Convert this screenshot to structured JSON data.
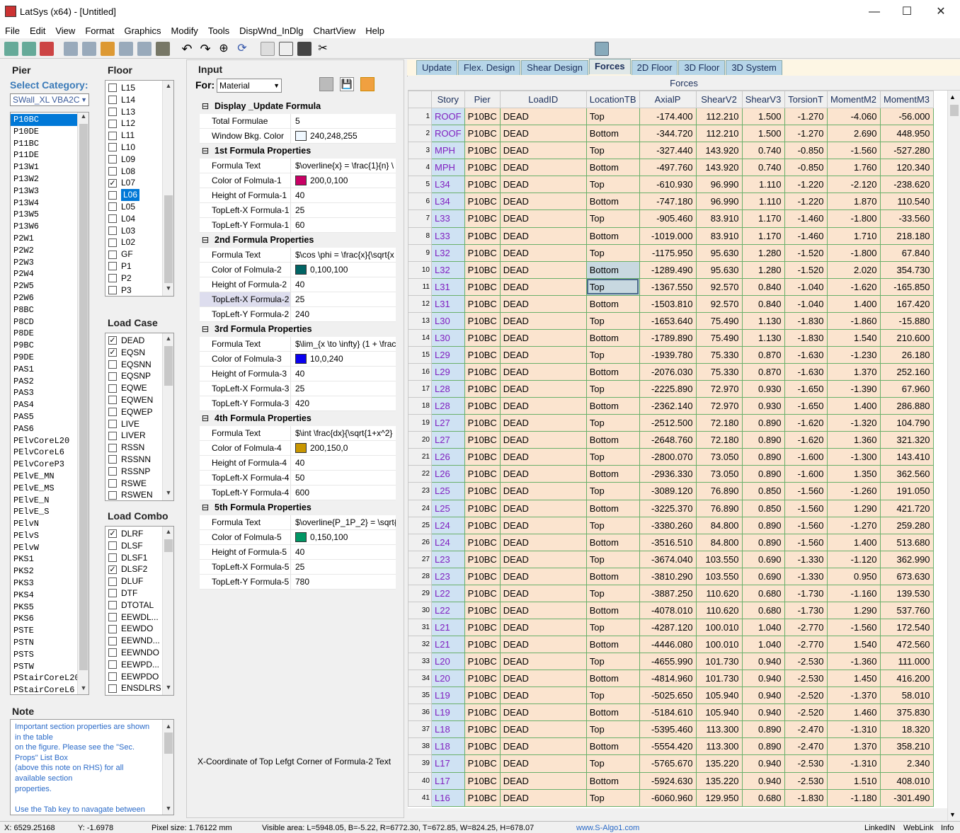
{
  "window": {
    "title": "LatSys (x64) - [Untitled]",
    "min": "—",
    "max": "☐",
    "close": "✕"
  },
  "menu": [
    "File",
    "Edit",
    "View",
    "Format",
    "Graphics",
    "Modify",
    "Tools",
    "DispWnd_InDlg",
    "ChartView",
    "Help"
  ],
  "pier": {
    "title": "Pier",
    "category_label": "Select Category:",
    "category_value": "SWall_XL VBA2C",
    "items": [
      "P10BC",
      "P10DE",
      "P11BC",
      "P11DE",
      "P13W1",
      "P13W2",
      "P13W3",
      "P13W4",
      "P13W5",
      "P13W6",
      "P2W1",
      "P2W2",
      "P2W3",
      "P2W4",
      "P2W5",
      "P2W6",
      "P8BC",
      "P8CD",
      "P8DE",
      "P9BC",
      "P9DE",
      "PAS1",
      "PAS2",
      "PAS3",
      "PAS4",
      "PAS5",
      "PAS6",
      "PElvCoreL20",
      "PElvCoreL6",
      "PElvCoreP3",
      "PElvE_MN",
      "PElvE_MS",
      "PElvE_N",
      "PElvE_S",
      "PElvN",
      "PElvS",
      "PElvW",
      "PKS1",
      "PKS2",
      "PKS3",
      "PKS4",
      "PKS5",
      "PKS6",
      "PSTE",
      "PSTN",
      "PSTS",
      "PSTW",
      "PStairCoreL20",
      "PStairCoreL6"
    ]
  },
  "floor": {
    "title": "Floor",
    "items": [
      {
        "l": "L15",
        "c": false
      },
      {
        "l": "L14",
        "c": false
      },
      {
        "l": "L13",
        "c": false
      },
      {
        "l": "L12",
        "c": false
      },
      {
        "l": "L11",
        "c": false
      },
      {
        "l": "L10",
        "c": false
      },
      {
        "l": "L09",
        "c": false
      },
      {
        "l": "L08",
        "c": false
      },
      {
        "l": "L07",
        "c": true
      },
      {
        "l": "L06",
        "c": false,
        "sel": true
      },
      {
        "l": "L05",
        "c": false
      },
      {
        "l": "L04",
        "c": false
      },
      {
        "l": "L03",
        "c": false
      },
      {
        "l": "L02",
        "c": false
      },
      {
        "l": "GF",
        "c": false
      },
      {
        "l": "P1",
        "c": false
      },
      {
        "l": "P2",
        "c": false
      },
      {
        "l": "P3",
        "c": false
      }
    ]
  },
  "load_case": {
    "title": "Load Case",
    "items": [
      {
        "l": "DEAD",
        "c": true
      },
      {
        "l": "EQSN",
        "c": true
      },
      {
        "l": "EQSNN",
        "c": false
      },
      {
        "l": "EQSNP",
        "c": false
      },
      {
        "l": "EQWE",
        "c": false
      },
      {
        "l": "EQWEN",
        "c": false
      },
      {
        "l": "EQWEP",
        "c": false
      },
      {
        "l": "LIVE",
        "c": false
      },
      {
        "l": "LIVER",
        "c": false
      },
      {
        "l": "RSSN",
        "c": false
      },
      {
        "l": "RSSNN",
        "c": false
      },
      {
        "l": "RSSNP",
        "c": false
      },
      {
        "l": "RSWE",
        "c": false
      },
      {
        "l": "RSWEN",
        "c": false
      }
    ]
  },
  "load_combo": {
    "title": "Load Combo",
    "items": [
      {
        "l": "DLRF",
        "c": true
      },
      {
        "l": "DLSF",
        "c": false
      },
      {
        "l": "DLSF1",
        "c": false
      },
      {
        "l": "DLSF2",
        "c": true
      },
      {
        "l": "DLUF",
        "c": false
      },
      {
        "l": "DTF",
        "c": false
      },
      {
        "l": "DTOTAL",
        "c": false
      },
      {
        "l": "EEWDL...",
        "c": false
      },
      {
        "l": "EEWDO",
        "c": false
      },
      {
        "l": "EEWND...",
        "c": false
      },
      {
        "l": "EEWNDO",
        "c": false
      },
      {
        "l": "EEWPD...",
        "c": false
      },
      {
        "l": "EEWPDO",
        "c": false
      },
      {
        "l": "ENSDLRS",
        "c": false
      }
    ]
  },
  "note": {
    "title": "Note",
    "lines": [
      "Important section properties are shown",
      "in the table",
      "on the figure. Please see the \"Sec.",
      "Props\" List Box",
      "(above this note on RHS) for all",
      "available section",
      "properties.",
      "",
      "Use the Tab key to navagate between"
    ]
  },
  "input": {
    "title": "Input",
    "for_label": "For:",
    "for_value": "Material",
    "hint": "X-Coordinate of Top Lefgt Corner of Formula-2 Text",
    "sections": [
      {
        "title": "Display _Update Formula",
        "rows": [
          {
            "k": "Total Formulae",
            "v": "5"
          },
          {
            "k": "Window Bkg. Color",
            "v": "240,248,255",
            "sw": "#f0f8ff"
          }
        ]
      },
      {
        "title": "1st Formula Properties",
        "rows": [
          {
            "k": "Formula Text",
            "v": "$\\overline{x} = \\frac{1}{n} \\"
          },
          {
            "k": "Color of Folmula-1",
            "v": "200,0,100",
            "sw": "#c80064"
          },
          {
            "k": "Height of Formula-1",
            "v": "40"
          },
          {
            "k": "TopLeft-X Formula-1",
            "v": "25"
          },
          {
            "k": "TopLeft-Y Formula-1",
            "v": "60"
          }
        ]
      },
      {
        "title": "2nd Formula Properties",
        "rows": [
          {
            "k": "Formula Text",
            "v": "$\\cos \\phi = \\frac{x}{\\sqrt{x"
          },
          {
            "k": "Color of Folmula-2",
            "v": "0,100,100",
            "sw": "#006464"
          },
          {
            "k": "Height of Formula-2",
            "v": "40"
          },
          {
            "k": "TopLeft-X Formula-2",
            "v": "25",
            "hl": true
          },
          {
            "k": "TopLeft-Y Formula-2",
            "v": "240"
          }
        ]
      },
      {
        "title": "3rd Formula Properties",
        "rows": [
          {
            "k": "Formula Text",
            "v": "$\\lim_{x \\to \\infty} (1 + \\frac"
          },
          {
            "k": "Color of Folmula-3",
            "v": "10,0,240",
            "sw": "#0a00f0"
          },
          {
            "k": "Height of Formula-3",
            "v": "40"
          },
          {
            "k": "TopLeft-X Formula-3",
            "v": "25"
          },
          {
            "k": "TopLeft-Y Formula-3",
            "v": "420"
          }
        ]
      },
      {
        "title": "4th Formula Properties",
        "rows": [
          {
            "k": "Formula Text",
            "v": "$\\int \\frac{dx}{\\sqrt{1+x^2}"
          },
          {
            "k": "Color of Folmula-4",
            "v": "200,150,0",
            "sw": "#c89600"
          },
          {
            "k": "Height of Formula-4",
            "v": "40"
          },
          {
            "k": "TopLeft-X Formula-4",
            "v": "50"
          },
          {
            "k": "TopLeft-Y Formula-4",
            "v": "600"
          }
        ]
      },
      {
        "title": "5th Formula Properties",
        "rows": [
          {
            "k": "Formula Text",
            "v": "$\\overline{P_1P_2} = \\sqrt{"
          },
          {
            "k": "Color of Folmula-5",
            "v": "0,150,100",
            "sw": "#009664"
          },
          {
            "k": "Height of Formula-5",
            "v": "40"
          },
          {
            "k": "TopLeft-X Formula-5",
            "v": "25"
          },
          {
            "k": "TopLeft-Y Formula-5",
            "v": "780"
          }
        ]
      }
    ]
  },
  "tabs": [
    "Update",
    "Flex. Design",
    "Shear Design",
    "Forces",
    "2D Floor",
    "3D Floor",
    "3D System"
  ],
  "active_tab": "Forces",
  "grid": {
    "title": "Forces",
    "columns": [
      "Story",
      "Pier",
      "LoadID",
      "LocationTB",
      "AxialP",
      "ShearV2",
      "ShearV3",
      "TorsionT",
      "MomentM2",
      "MomentM3"
    ],
    "rows": [
      [
        "ROOF",
        "P10BC",
        "DEAD",
        "Top",
        "-174.400",
        "112.210",
        "1.500",
        "-1.270",
        "-4.060",
        "-56.000"
      ],
      [
        "ROOF",
        "P10BC",
        "DEAD",
        "Bottom",
        "-344.720",
        "112.210",
        "1.500",
        "-1.270",
        "2.690",
        "448.950"
      ],
      [
        "MPH",
        "P10BC",
        "DEAD",
        "Top",
        "-327.440",
        "143.920",
        "0.740",
        "-0.850",
        "-1.560",
        "-527.280"
      ],
      [
        "MPH",
        "P10BC",
        "DEAD",
        "Bottom",
        "-497.760",
        "143.920",
        "0.740",
        "-0.850",
        "1.760",
        "120.340"
      ],
      [
        "L34",
        "P10BC",
        "DEAD",
        "Top",
        "-610.930",
        "96.990",
        "1.110",
        "-1.220",
        "-2.120",
        "-238.620"
      ],
      [
        "L34",
        "P10BC",
        "DEAD",
        "Bottom",
        "-747.180",
        "96.990",
        "1.110",
        "-1.220",
        "1.870",
        "110.540"
      ],
      [
        "L33",
        "P10BC",
        "DEAD",
        "Top",
        "-905.460",
        "83.910",
        "1.170",
        "-1.460",
        "-1.800",
        "-33.560"
      ],
      [
        "L33",
        "P10BC",
        "DEAD",
        "Bottom",
        "-1019.000",
        "83.910",
        "1.170",
        "-1.460",
        "1.710",
        "218.180"
      ],
      [
        "L32",
        "P10BC",
        "DEAD",
        "Top",
        "-1175.950",
        "95.630",
        "1.280",
        "-1.520",
        "-1.800",
        "67.840"
      ],
      [
        "L32",
        "P10BC",
        "DEAD",
        "Bottom",
        "-1289.490",
        "95.630",
        "1.280",
        "-1.520",
        "2.020",
        "354.730"
      ],
      [
        "L31",
        "P10BC",
        "DEAD",
        "Top",
        "-1367.550",
        "92.570",
        "0.840",
        "-1.040",
        "-1.620",
        "-165.850"
      ],
      [
        "L31",
        "P10BC",
        "DEAD",
        "Bottom",
        "-1503.810",
        "92.570",
        "0.840",
        "-1.040",
        "1.400",
        "167.420"
      ],
      [
        "L30",
        "P10BC",
        "DEAD",
        "Top",
        "-1653.640",
        "75.490",
        "1.130",
        "-1.830",
        "-1.860",
        "-15.880"
      ],
      [
        "L30",
        "P10BC",
        "DEAD",
        "Bottom",
        "-1789.890",
        "75.490",
        "1.130",
        "-1.830",
        "1.540",
        "210.600"
      ],
      [
        "L29",
        "P10BC",
        "DEAD",
        "Top",
        "-1939.780",
        "75.330",
        "0.870",
        "-1.630",
        "-1.230",
        "26.180"
      ],
      [
        "L29",
        "P10BC",
        "DEAD",
        "Bottom",
        "-2076.030",
        "75.330",
        "0.870",
        "-1.630",
        "1.370",
        "252.160"
      ],
      [
        "L28",
        "P10BC",
        "DEAD",
        "Top",
        "-2225.890",
        "72.970",
        "0.930",
        "-1.650",
        "-1.390",
        "67.960"
      ],
      [
        "L28",
        "P10BC",
        "DEAD",
        "Bottom",
        "-2362.140",
        "72.970",
        "0.930",
        "-1.650",
        "1.400",
        "286.880"
      ],
      [
        "L27",
        "P10BC",
        "DEAD",
        "Top",
        "-2512.500",
        "72.180",
        "0.890",
        "-1.620",
        "-1.320",
        "104.790"
      ],
      [
        "L27",
        "P10BC",
        "DEAD",
        "Bottom",
        "-2648.760",
        "72.180",
        "0.890",
        "-1.620",
        "1.360",
        "321.320"
      ],
      [
        "L26",
        "P10BC",
        "DEAD",
        "Top",
        "-2800.070",
        "73.050",
        "0.890",
        "-1.600",
        "-1.300",
        "143.410"
      ],
      [
        "L26",
        "P10BC",
        "DEAD",
        "Bottom",
        "-2936.330",
        "73.050",
        "0.890",
        "-1.600",
        "1.350",
        "362.560"
      ],
      [
        "L25",
        "P10BC",
        "DEAD",
        "Top",
        "-3089.120",
        "76.890",
        "0.850",
        "-1.560",
        "-1.260",
        "191.050"
      ],
      [
        "L25",
        "P10BC",
        "DEAD",
        "Bottom",
        "-3225.370",
        "76.890",
        "0.850",
        "-1.560",
        "1.290",
        "421.720"
      ],
      [
        "L24",
        "P10BC",
        "DEAD",
        "Top",
        "-3380.260",
        "84.800",
        "0.890",
        "-1.560",
        "-1.270",
        "259.280"
      ],
      [
        "L24",
        "P10BC",
        "DEAD",
        "Bottom",
        "-3516.510",
        "84.800",
        "0.890",
        "-1.560",
        "1.400",
        "513.680"
      ],
      [
        "L23",
        "P10BC",
        "DEAD",
        "Top",
        "-3674.040",
        "103.550",
        "0.690",
        "-1.330",
        "-1.120",
        "362.990"
      ],
      [
        "L23",
        "P10BC",
        "DEAD",
        "Bottom",
        "-3810.290",
        "103.550",
        "0.690",
        "-1.330",
        "0.950",
        "673.630"
      ],
      [
        "L22",
        "P10BC",
        "DEAD",
        "Top",
        "-3887.250",
        "110.620",
        "0.680",
        "-1.730",
        "-1.160",
        "139.530"
      ],
      [
        "L22",
        "P10BC",
        "DEAD",
        "Bottom",
        "-4078.010",
        "110.620",
        "0.680",
        "-1.730",
        "1.290",
        "537.760"
      ],
      [
        "L21",
        "P10BC",
        "DEAD",
        "Top",
        "-4287.120",
        "100.010",
        "1.040",
        "-2.770",
        "-1.560",
        "172.540"
      ],
      [
        "L21",
        "P10BC",
        "DEAD",
        "Bottom",
        "-4446.080",
        "100.010",
        "1.040",
        "-2.770",
        "1.540",
        "472.560"
      ],
      [
        "L20",
        "P10BC",
        "DEAD",
        "Top",
        "-4655.990",
        "101.730",
        "0.940",
        "-2.530",
        "-1.360",
        "111.000"
      ],
      [
        "L20",
        "P10BC",
        "DEAD",
        "Bottom",
        "-4814.960",
        "101.730",
        "0.940",
        "-2.530",
        "1.450",
        "416.200"
      ],
      [
        "L19",
        "P10BC",
        "DEAD",
        "Top",
        "-5025.650",
        "105.940",
        "0.940",
        "-2.520",
        "-1.370",
        "58.010"
      ],
      [
        "L19",
        "P10BC",
        "DEAD",
        "Bottom",
        "-5184.610",
        "105.940",
        "0.940",
        "-2.520",
        "1.460",
        "375.830"
      ],
      [
        "L18",
        "P10BC",
        "DEAD",
        "Top",
        "-5395.460",
        "113.300",
        "0.890",
        "-2.470",
        "-1.310",
        "18.320"
      ],
      [
        "L18",
        "P10BC",
        "DEAD",
        "Bottom",
        "-5554.420",
        "113.300",
        "0.890",
        "-2.470",
        "1.370",
        "358.210"
      ],
      [
        "L17",
        "P10BC",
        "DEAD",
        "Top",
        "-5765.670",
        "135.220",
        "0.940",
        "-2.530",
        "-1.310",
        "2.340"
      ],
      [
        "L17",
        "P10BC",
        "DEAD",
        "Bottom",
        "-5924.630",
        "135.220",
        "0.940",
        "-2.530",
        "1.510",
        "408.010"
      ],
      [
        "L16",
        "P10BC",
        "DEAD",
        "Top",
        "-6060.960",
        "129.950",
        "0.680",
        "-1.830",
        "-1.180",
        "-301.490"
      ]
    ]
  },
  "status": {
    "x": "X: 6529.25168",
    "y": "Y: -1.6978",
    "pixel": "Pixel size: 1.76122 mm",
    "visible": "Visible area:  L=5948.05, B=-5.22, R=6772.30, T=672.85, W=824.25, H=678.07",
    "url": "www.S-Algo1.com",
    "linkedin": "LinkedIN",
    "weblink": "WebLink",
    "info": "Info"
  }
}
